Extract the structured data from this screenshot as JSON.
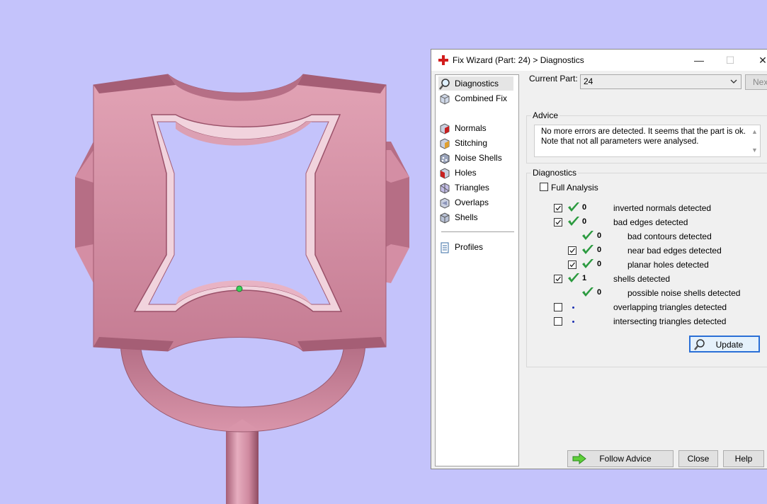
{
  "dialog": {
    "title": "Fix Wizard (Part: 24) > Diagnostics",
    "controls": {
      "minimize": "—",
      "maximize": "☐",
      "close": "✕"
    }
  },
  "nav": {
    "items": [
      {
        "label": "Diagnostics",
        "icon": "magnifier-icon",
        "selected": true
      },
      {
        "label": "Combined Fix",
        "icon": "cube-icon"
      },
      {
        "label": "Normals",
        "icon": "normals-cube-icon"
      },
      {
        "label": "Stitching",
        "icon": "stitching-cube-icon"
      },
      {
        "label": "Noise Shells",
        "icon": "noise-shells-icon"
      },
      {
        "label": "Holes",
        "icon": "holes-cube-icon"
      },
      {
        "label": "Triangles",
        "icon": "triangles-cube-icon"
      },
      {
        "label": "Overlaps",
        "icon": "overlaps-cube-icon"
      },
      {
        "label": "Shells",
        "icon": "shells-cube-icon"
      }
    ],
    "profiles": {
      "label": "Profiles",
      "icon": "document-icon"
    }
  },
  "current_part": {
    "label": "Current Part:",
    "value": "24",
    "next_label": "Next"
  },
  "advice": {
    "title": "Advice",
    "text_line1": "No more errors are detected. It seems that the part is ok.",
    "text_line2": "Note that not all parameters were analysed."
  },
  "diagnostics": {
    "title": "Diagnostics",
    "full_analysis_label": "Full Analysis",
    "rows": [
      {
        "checkbox": true,
        "checked": true,
        "status": "ok",
        "count": "0",
        "label": "inverted normals detected",
        "indent": 0
      },
      {
        "checkbox": true,
        "checked": true,
        "status": "ok",
        "count": "0",
        "label": "bad edges detected",
        "indent": 0
      },
      {
        "checkbox": false,
        "checked": false,
        "status": "ok",
        "count": "0",
        "label": "bad contours detected",
        "indent": 1
      },
      {
        "checkbox": true,
        "checked": true,
        "status": "ok",
        "count": "0",
        "label": "near bad edges detected",
        "indent": 1
      },
      {
        "checkbox": true,
        "checked": true,
        "status": "ok",
        "count": "0",
        "label": "planar holes detected",
        "indent": 1
      },
      {
        "checkbox": true,
        "checked": true,
        "status": "ok",
        "count": "1",
        "label": "shells detected",
        "indent": 0
      },
      {
        "checkbox": false,
        "checked": false,
        "status": "ok",
        "count": "0",
        "label": "possible noise shells detected",
        "indent": 1
      },
      {
        "checkbox": true,
        "checked": false,
        "status": "pending",
        "count": "",
        "label": "overlapping triangles detected",
        "indent": 0
      },
      {
        "checkbox": true,
        "checked": false,
        "status": "pending",
        "count": "",
        "label": "intersecting triangles detected",
        "indent": 0
      }
    ],
    "update_label": "Update"
  },
  "buttons": {
    "follow_advice": "Follow Advice",
    "close": "Close",
    "help": "Help"
  },
  "colors": {
    "viewport_bg": "#c4c3fb",
    "part_pink": "#d58fa5",
    "tick_green": "#2b9a3f",
    "update_border": "#2a6fd6"
  }
}
